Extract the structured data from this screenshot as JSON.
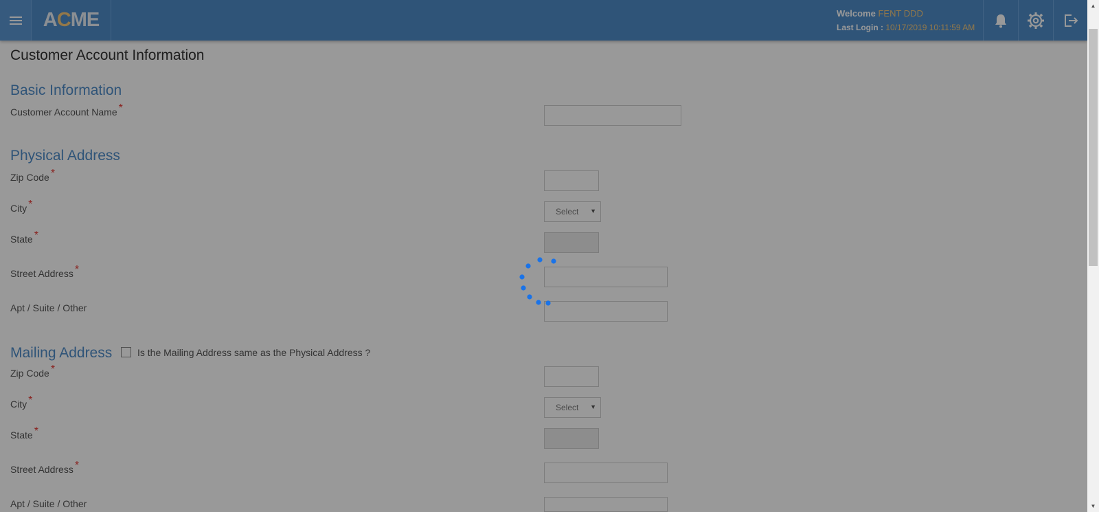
{
  "header": {
    "logo_part1": "A",
    "logo_part2": "C",
    "logo_part3": "ME",
    "welcome_prefix": "Welcome",
    "user_name": "FENT DDD",
    "last_login_label": "Last Login :",
    "last_login_value": "10/17/2019 10:11:59 AM"
  },
  "page": {
    "title": "Customer Account Information"
  },
  "basic_info": {
    "title": "Basic Information",
    "account_name_label": "Customer Account Name",
    "required_mark": "*"
  },
  "physical": {
    "title": "Physical Address",
    "zip_label": "Zip Code",
    "city_label": "City",
    "city_select": "Select",
    "state_label": "State",
    "street_label": "Street Address",
    "apt_label": "Apt / Suite / Other"
  },
  "mailing": {
    "title": "Mailing Address",
    "same_as_physical": "Is the Mailing Address same as the Physical Address ?",
    "zip_label": "Zip Code",
    "city_label": "City",
    "city_select": "Select",
    "state_label": "State",
    "street_label": "Street Address",
    "apt_label": "Apt / Suite / Other"
  },
  "colors": {
    "header": "#4f8cc9",
    "accent": "#4f8cc9",
    "required": "#e53935",
    "spinner": "#1a73e8",
    "highlight": "#f5c97a"
  },
  "icons": {
    "menu": "hamburger-icon",
    "notifications": "bell-icon",
    "settings": "gear-icon",
    "logout": "logout-icon"
  }
}
